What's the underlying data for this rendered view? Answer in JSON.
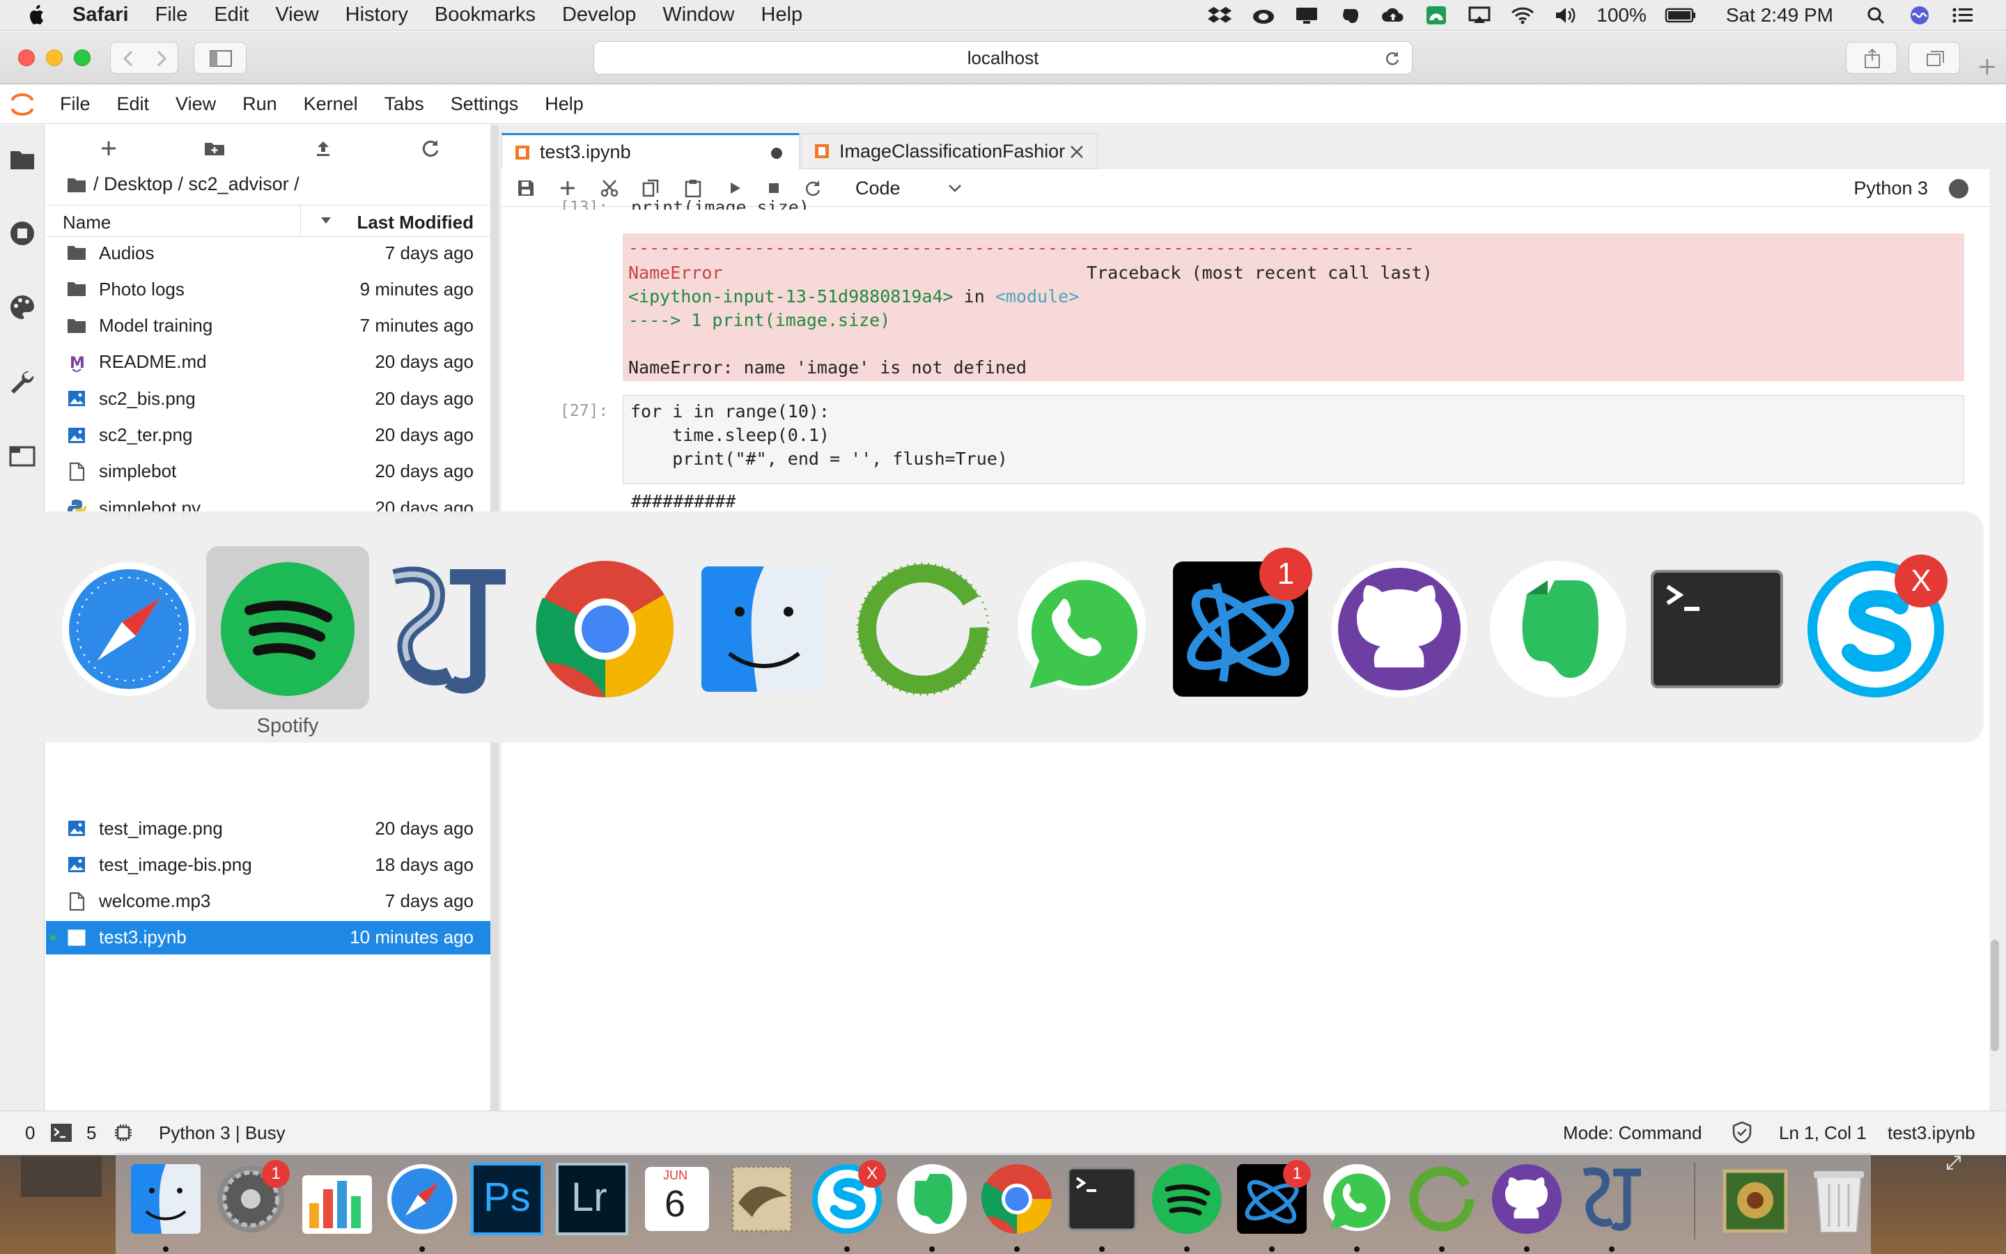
{
  "menubar": {
    "app_name": "Safari",
    "items": [
      "File",
      "Edit",
      "View",
      "History",
      "Bookmarks",
      "Develop",
      "Window",
      "Help"
    ],
    "battery": "100%",
    "clock": "Sat 2:49 PM"
  },
  "safari": {
    "url": "localhost"
  },
  "jupyter_menu": [
    "File",
    "Edit",
    "View",
    "Run",
    "Kernel",
    "Tabs",
    "Settings",
    "Help"
  ],
  "file_browser": {
    "breadcrumb": "/ Desktop / sc2_advisor /",
    "col_name": "Name",
    "col_modified": "Last Modified",
    "files": [
      {
        "name": "Audios",
        "modified": "7 days ago",
        "icon": "folder-icon"
      },
      {
        "name": "Photo logs",
        "modified": "9 minutes ago",
        "icon": "folder-icon"
      },
      {
        "name": "Model training",
        "modified": "7 minutes ago",
        "icon": "folder-icon"
      },
      {
        "name": "README.md",
        "modified": "20 days ago",
        "icon": "markdown-icon"
      },
      {
        "name": "sc2_bis.png",
        "modified": "20 days ago",
        "icon": "image-file-icon"
      },
      {
        "name": "sc2_ter.png",
        "modified": "20 days ago",
        "icon": "image-file-icon"
      },
      {
        "name": "simplebot",
        "modified": "20 days ago",
        "icon": "file-icon"
      },
      {
        "name": "simplebot.py",
        "modified": "20 days ago",
        "icon": "python-icon"
      },
      {
        "name": "test_image.png",
        "modified": "20 days ago",
        "icon": "image-file-icon"
      },
      {
        "name": "test_image-bis.png",
        "modified": "18 days ago",
        "icon": "image-file-icon"
      },
      {
        "name": "welcome.mp3",
        "modified": "7 days ago",
        "icon": "file-icon"
      },
      {
        "name": "test3.ipynb",
        "modified": "10 minutes ago",
        "icon": "notebook-icon",
        "selected": true
      }
    ]
  },
  "notebook": {
    "tabs": [
      {
        "label": "test3.ipynb"
      },
      {
        "label": "ImageClassificationFashior"
      }
    ],
    "cell_type": "Code",
    "kernel": "Python 3",
    "prev_cell_partial": "print(image.size)",
    "prev_prompt": "[13]:",
    "error": {
      "dashes": "---------------------------------------------------------------------------",
      "name": "NameError",
      "traceback_title": "Traceback (most recent call last)",
      "input_ref": "<ipython-input-13-51d9880819a4>",
      "in_word": " in ",
      "module": "<module>",
      "arrow_line": "----> 1 print(image.size)",
      "message": "NameError: name 'image' is not defined"
    },
    "cell_prompt": "[27]:",
    "code_lines": [
      "for i in range(10):",
      "    time.sleep(0.1)",
      "    print(\"#\", end = '', flush=True)"
    ],
    "output": "##########"
  },
  "app_switcher": {
    "selected_label": "Spotify",
    "apps": [
      "Safari",
      "Spotify",
      "StarCraft II",
      "Google Chrome",
      "Finder",
      "Arduino-like IDE",
      "WhatsApp",
      "Battle.net",
      "GitHub Desktop",
      "Evernote",
      "Terminal",
      "Skype"
    ],
    "battlenet_badge": "1",
    "skype_badge": "X"
  },
  "status_bar": {
    "left_count": "0",
    "terminals": "5",
    "kernel_status": "Python 3 | Busy",
    "mode": "Mode: Command",
    "cursor": "Ln 1, Col 1",
    "file": "test3.ipynb"
  },
  "dock": {
    "calendar_month": "JUN",
    "calendar_day": "6",
    "prefs_badge": "1",
    "skype_badge": "X",
    "battlenet_badge": "1",
    "ps_label": "Ps",
    "lr_label": "Lr"
  }
}
